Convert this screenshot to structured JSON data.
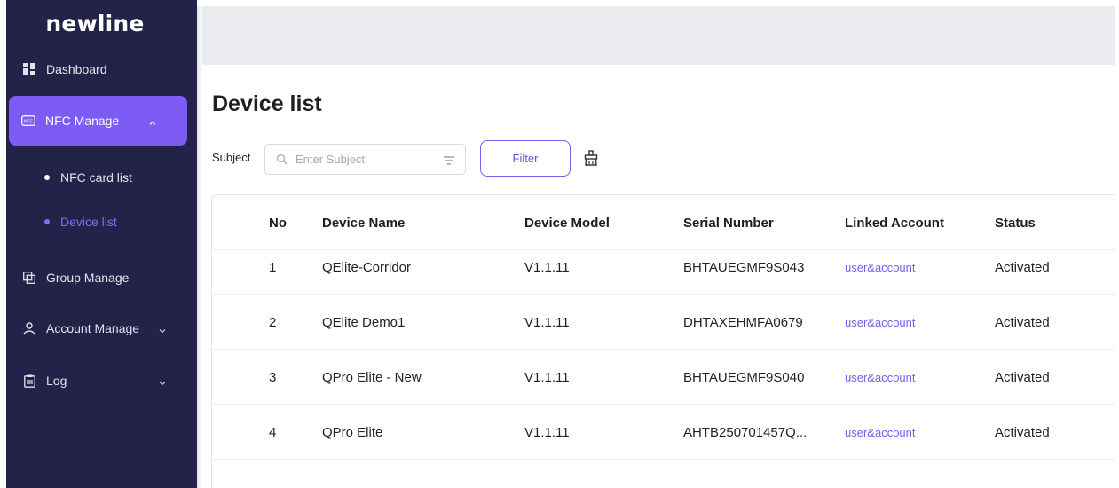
{
  "brand": "newline",
  "sidebar": {
    "items": [
      {
        "label": "Dashboard",
        "icon": "dashboard-icon"
      },
      {
        "label": "NFC Manage",
        "icon": "nfc-icon"
      },
      {
        "label": "Group Manage",
        "icon": "group-icon"
      },
      {
        "label": "Account Manage",
        "icon": "user-icon"
      },
      {
        "label": "Log",
        "icon": "clipboard-icon"
      }
    ],
    "nfc_subitems": [
      {
        "label": "NFC card list"
      },
      {
        "label": "Device list"
      }
    ],
    "active_item": "NFC Manage",
    "active_subitem": "Device list",
    "accent_color": "#7c5cf2"
  },
  "page": {
    "title": "Device list",
    "subject_label": "Subject",
    "subject_placeholder": "Enter Subject",
    "filter_label": "Filter"
  },
  "table": {
    "columns": [
      "No",
      "Device Name",
      "Device Model",
      "Serial Number",
      "Linked Account",
      "Status"
    ],
    "rows": [
      {
        "no": "1",
        "name": "QElite-Corridor",
        "model": "V1.1.11",
        "serial": "BHTAUEGMF9S043",
        "linked": "user&account",
        "status": "Activated"
      },
      {
        "no": "2",
        "name": "QElite Demo1",
        "model": "V1.1.11",
        "serial": "DHTAXEHMFA0679",
        "linked": "user&account",
        "status": "Activated"
      },
      {
        "no": "3",
        "name": "QPro Elite - New",
        "model": "V1.1.11",
        "serial": "BHTAUEGMF9S040",
        "linked": "user&account",
        "status": "Activated"
      },
      {
        "no": "4",
        "name": "QPro Elite",
        "model": "V1.1.11",
        "serial": "AHTB250701457Q...",
        "linked": "user&account",
        "status": "Activated"
      }
    ]
  }
}
